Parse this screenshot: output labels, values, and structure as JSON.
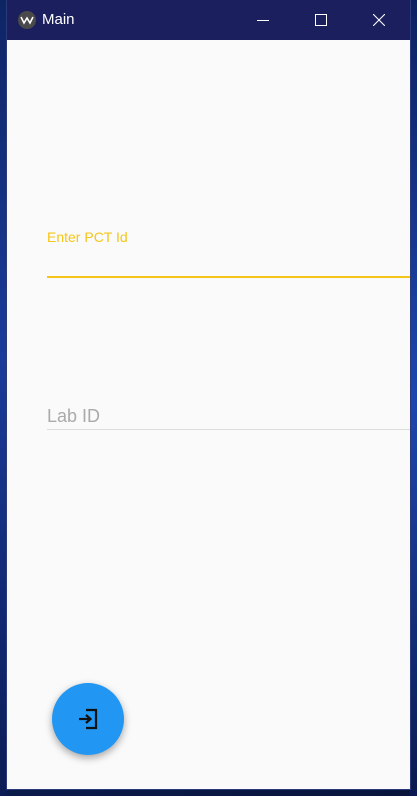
{
  "window": {
    "title": "Main"
  },
  "titlebar_buttons": {
    "minimize_icon": "minimize-icon",
    "maximize_icon": "maximize-icon",
    "close_icon": "close-icon"
  },
  "form": {
    "pct_field": {
      "label": "Enter PCT Id",
      "value": ""
    },
    "lab_field": {
      "placeholder": "Lab ID",
      "value": ""
    }
  },
  "fab": {
    "icon": "login-icon"
  },
  "colors": {
    "titlebar": "#1c1f5e",
    "focus_accent": "#f5c518",
    "fab": "#2196f3",
    "background": "#fafafa"
  }
}
